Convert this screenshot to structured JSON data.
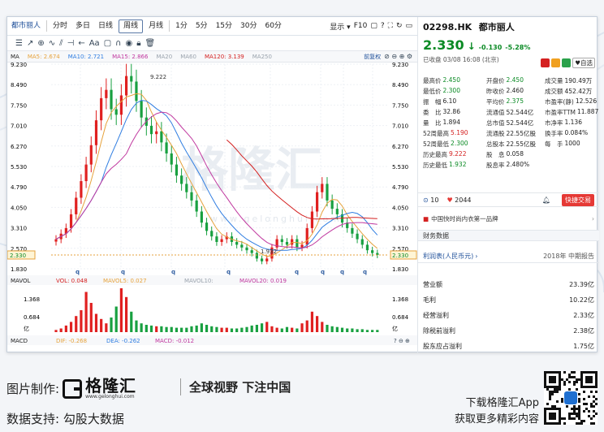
{
  "toolbar": {
    "tabs": [
      "都市丽人",
      "分时",
      "多日",
      "日线",
      "周线",
      "月线",
      "1分",
      "5分",
      "15分",
      "30分",
      "60分"
    ],
    "active_tab": "周线",
    "display": "显示",
    "f10": "F10"
  },
  "indicators": {
    "ma_label": "MA",
    "ma5": "MA5: 2.674",
    "ma10": "MA10: 2.721",
    "ma15": "MA15: 2.866",
    "ma20": "MA20",
    "ma60": "MA60",
    "ma120": "MA120: 3.139",
    "ma250": "MA250",
    "rights": "前复权",
    "mavol_label": "MAVOL",
    "vol": "VOL: 0.048",
    "mavol5": "MAVOL5: 0.027",
    "mavol10": "MAVOL10:",
    "mavol20": "MAVOL20: 0.019",
    "macd_label": "MACD",
    "dif": "DIF: -0.268",
    "dea": "DEA: -0.262",
    "macd": "MACD: -0.012"
  },
  "chart_data": {
    "type": "candlestick",
    "price_ticks": [
      "9.230",
      "8.490",
      "7.750",
      "7.010",
      "6.270",
      "5.530",
      "4.790",
      "4.050",
      "3.310",
      "2.570",
      "1.830"
    ],
    "ylim": [
      1.83,
      9.23
    ],
    "current_price": "2.330",
    "annotations": {
      "high": "9.222",
      "low": "1.932"
    },
    "period_markers": [
      "q",
      "q",
      "q",
      "q",
      "q",
      "q",
      "q",
      "q"
    ],
    "volume_ticks": [
      "1.368",
      "0.684",
      "亿"
    ],
    "close_series_approx": [
      2.9,
      3.1,
      3.3,
      3.8,
      4.4,
      5.0,
      5.6,
      6.3,
      7.2,
      8.0,
      8.3,
      7.6,
      7.4,
      8.1,
      8.8,
      8.6,
      7.9,
      7.3,
      7.0,
      6.7,
      6.8,
      6.4,
      6.0,
      5.6,
      5.2,
      4.9,
      4.6,
      4.3,
      3.9,
      3.5,
      3.2,
      3.0,
      2.8,
      2.9,
      3.0,
      2.8,
      2.7,
      2.6,
      2.5,
      2.4,
      2.2,
      2.1,
      2.2,
      2.6,
      2.9,
      2.8,
      2.7,
      2.9,
      2.6,
      2.7,
      3.3,
      3.9,
      4.6,
      4.9,
      4.3,
      4.0,
      3.8,
      3.5,
      3.3,
      3.1,
      2.9,
      2.7,
      2.5,
      2.4,
      2.33
    ]
  },
  "quote": {
    "code": "02298.HK",
    "name": "都市丽人",
    "price": "2.330",
    "arrow": "↓",
    "change": "-0.130",
    "pct": "-5.28%",
    "status": "已收盘 03/08 16:08 (北京)",
    "watch": "自选",
    "rows": [
      [
        [
          "最高价",
          "2.450",
          "green"
        ],
        [
          "开盘价",
          "2.450",
          "green"
        ],
        [
          "成交量",
          "190.49万",
          "dark"
        ]
      ],
      [
        [
          "最低价",
          "2.300",
          "green"
        ],
        [
          "昨收价",
          "2.460",
          "dark"
        ],
        [
          "成交额",
          "452.42万",
          "dark"
        ]
      ],
      [
        [
          "振　幅",
          "6.10",
          "dark"
        ],
        [
          "平均价",
          "2.375",
          "green"
        ],
        [
          "市盈率(静)",
          "12.526",
          "dark"
        ]
      ],
      [
        [
          "委　比",
          "32.86",
          "dark"
        ],
        [
          "流通值",
          "52.544亿",
          "dark"
        ],
        [
          "市盈率TTM",
          "11.887",
          "dark"
        ]
      ],
      [
        [
          "量　比",
          "1.894",
          "dark"
        ],
        [
          "总市值",
          "52.544亿",
          "dark"
        ],
        [
          "市净率",
          "1.136",
          "dark"
        ]
      ],
      [
        [
          "52周最高",
          "5.190",
          "red"
        ],
        [
          "流通股",
          "22.55亿股",
          "dark"
        ],
        [
          "换手率",
          "0.084%",
          "dark"
        ]
      ],
      [
        [
          "52周最低",
          "2.300",
          "green"
        ],
        [
          "总股本",
          "22.55亿股",
          "dark"
        ],
        [
          "每　手",
          "1000",
          "dark"
        ]
      ],
      [
        [
          "历史最高",
          "9.222",
          "red"
        ],
        [
          "股　息",
          "0.058",
          "dark"
        ],
        [
          "",
          "",
          "dark"
        ]
      ],
      [
        [
          "历史最低",
          "1.932",
          "green"
        ],
        [
          "股息率",
          "2.480%",
          "dark"
        ],
        [
          "",
          "",
          "dark"
        ]
      ]
    ],
    "followers": "10",
    "likes": "2044",
    "trade": "快捷交易",
    "news": "中国快时尚内衣第一品牌",
    "fin_title": "财务数据",
    "fin_head_left": "利润表(人民币元)",
    "fin_head_right": "2018年 中期报告",
    "fin_rows": [
      [
        "营业额",
        "23.39亿"
      ],
      [
        "毛利",
        "10.22亿"
      ],
      [
        "经营溢利",
        "2.33亿"
      ],
      [
        "除税前溢利",
        "2.38亿"
      ],
      [
        "股东应占溢利",
        "1.75亿"
      ]
    ]
  },
  "footer": {
    "made_by": "图片制作:",
    "logo_cn": "格隆汇",
    "logo_en": "www.gelonghui.com",
    "slogan": "全球视野  下注中国",
    "support": "数据支持:  勾股大数据",
    "download": "下载格隆汇App",
    "more": "获取更多精彩内容"
  },
  "watermark": {
    "cn": "格隆汇",
    "en": "www.gelonghui.com"
  }
}
